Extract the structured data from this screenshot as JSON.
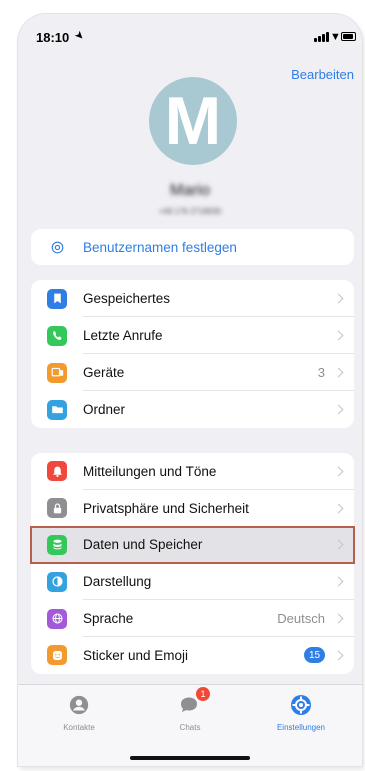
{
  "status_bar": {
    "time": "18:10"
  },
  "header": {
    "edit_label": "Bearbeiten"
  },
  "profile": {
    "avatar_letter": "M",
    "name": "Mario",
    "phone": "+49 176 2718930"
  },
  "group1": {
    "items": [
      {
        "label": "Benutzernamen festlegen",
        "icon": "at-sign-icon"
      }
    ]
  },
  "group2": {
    "items": [
      {
        "label": "Gespeichertes",
        "icon": "bookmark-icon",
        "color": "#2f7ee6"
      },
      {
        "label": "Letzte Anrufe",
        "icon": "phone-icon",
        "color": "#34c759"
      },
      {
        "label": "Geräte",
        "icon": "devices-icon",
        "color": "#f29a2e",
        "value": "3"
      },
      {
        "label": "Ordner",
        "icon": "folder-icon",
        "color": "#35a2e0"
      }
    ]
  },
  "group3": {
    "items": [
      {
        "label": "Mitteilungen und Töne",
        "icon": "bell-icon",
        "color": "#f0483b"
      },
      {
        "label": "Privatsphäre und Sicherheit",
        "icon": "lock-icon",
        "color": "#8e8e93"
      },
      {
        "label": "Daten und Speicher",
        "icon": "database-icon",
        "color": "#34c759"
      },
      {
        "label": "Darstellung",
        "icon": "half-circle-icon",
        "color": "#35a2e0"
      },
      {
        "label": "Sprache",
        "icon": "globe-icon",
        "color": "#a35ad9",
        "value": "Deutsch"
      },
      {
        "label": "Sticker und Emoji",
        "icon": "sticker-icon",
        "color": "#f29a2e",
        "badge": "15"
      }
    ]
  },
  "tabs": [
    {
      "label": "Kontakte",
      "icon": "person-icon"
    },
    {
      "label": "Chats",
      "icon": "chat-bubbles-icon",
      "badge": "1"
    },
    {
      "label": "Einstellungen",
      "icon": "gear-icon",
      "active": true
    }
  ],
  "colors": {
    "accent": "#2f7ee6",
    "selection_outline": "#b3604e"
  }
}
